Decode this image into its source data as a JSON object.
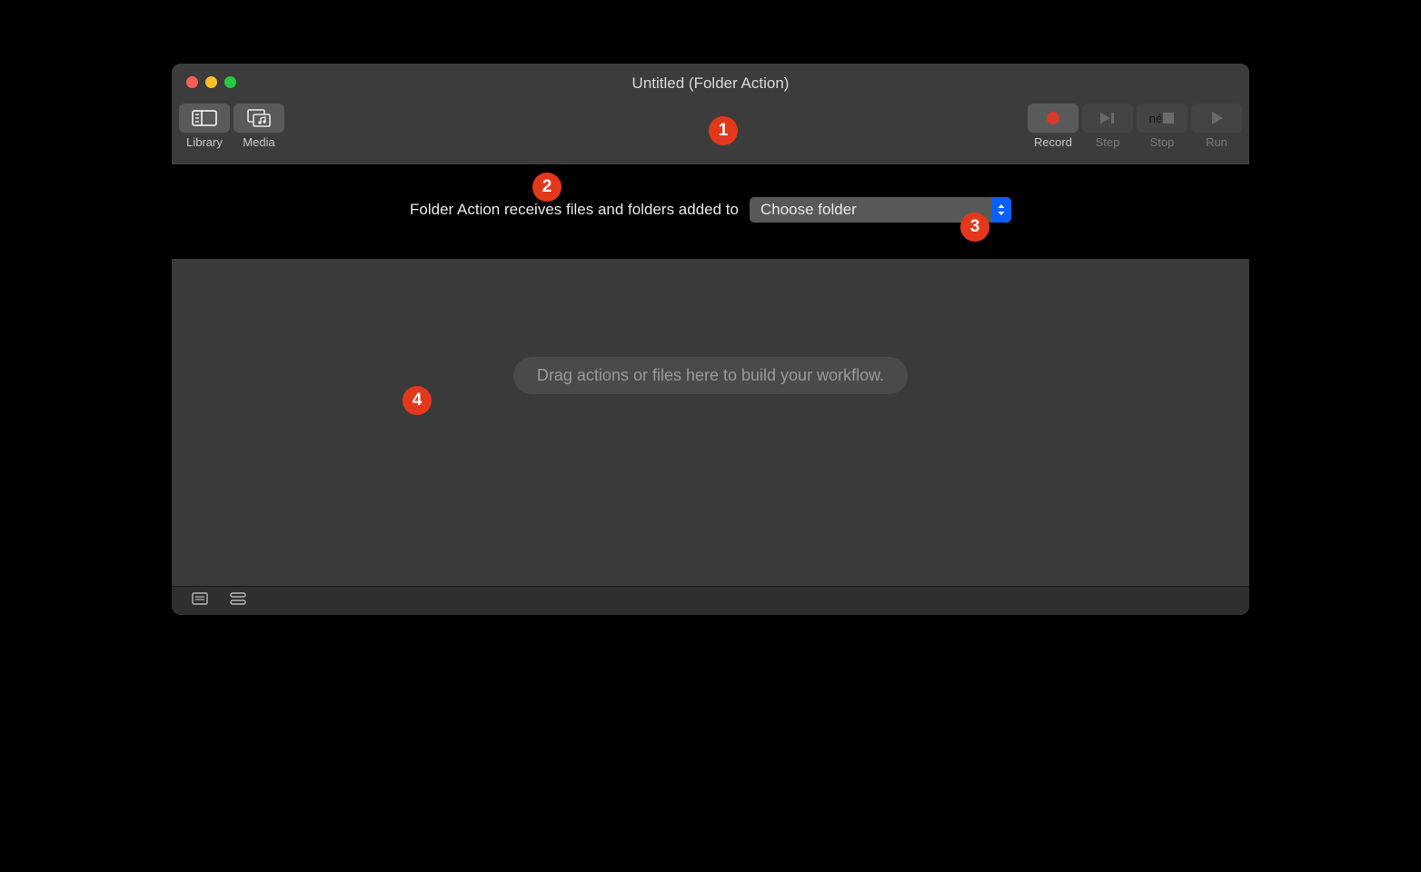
{
  "window": {
    "title": "Untitled (Folder Action)"
  },
  "toolbar": {
    "library_label": "Library",
    "media_label": "Media",
    "record_label": "Record",
    "step_label": "Step",
    "stop_label": "Stop",
    "run_label": "Run"
  },
  "header": {
    "prompt": "Folder Action receives files and folders added to",
    "folder_selected": "Choose folder"
  },
  "workflow": {
    "placeholder": "Drag actions or files here to build your workflow."
  },
  "callouts": {
    "c1": "1",
    "c2": "2",
    "c3": "3",
    "c4": "4"
  }
}
